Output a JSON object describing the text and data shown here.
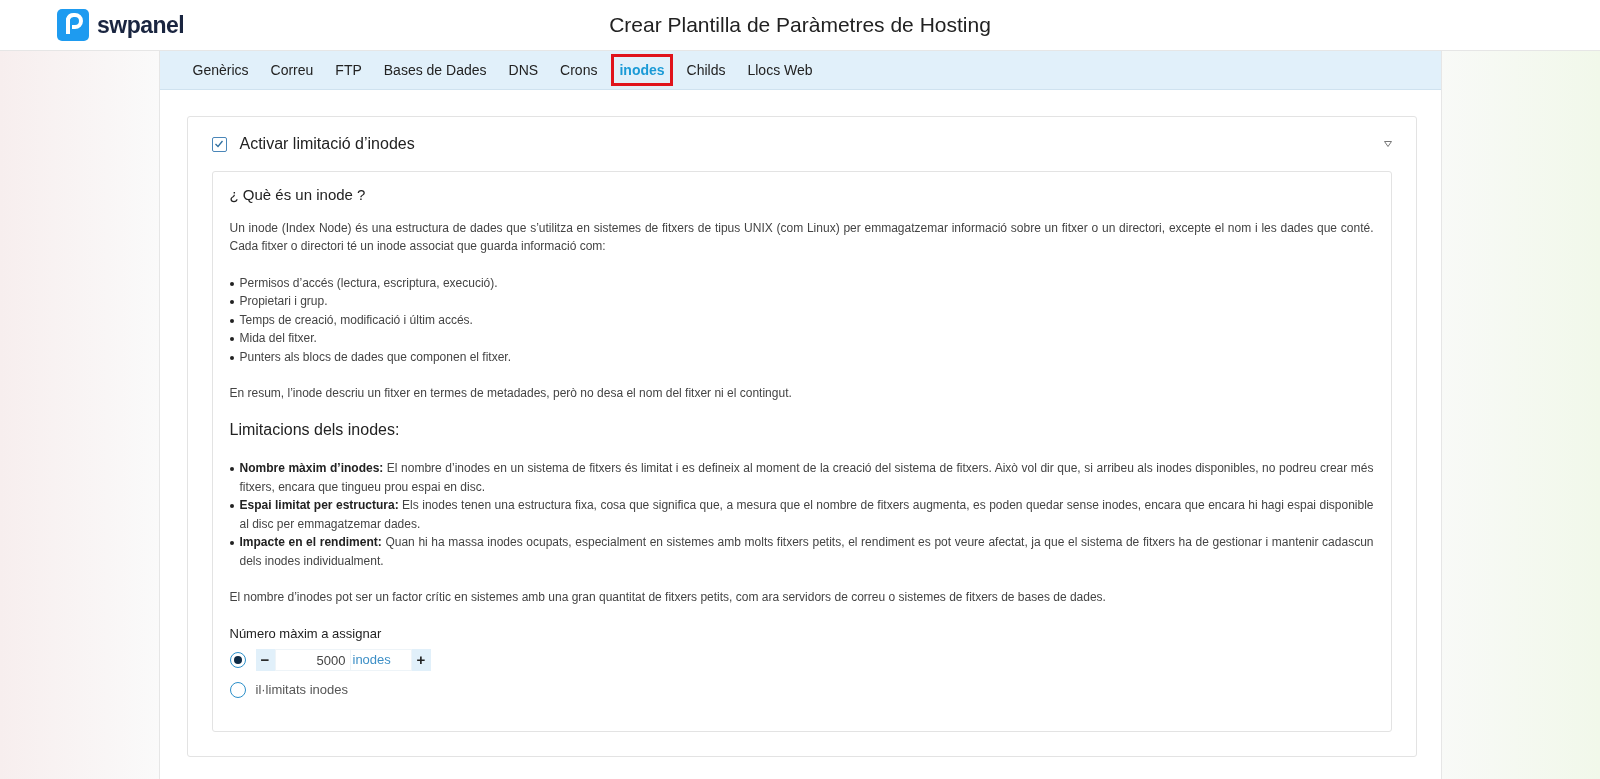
{
  "header": {
    "logo": "swpanel",
    "title": "Crear Plantilla de Paràmetres de Hosting"
  },
  "tabs": [
    {
      "label": "Genèrics",
      "selected": false
    },
    {
      "label": "Correu",
      "selected": false
    },
    {
      "label": "FTP",
      "selected": false
    },
    {
      "label": "Bases de Dades",
      "selected": false
    },
    {
      "label": "DNS",
      "selected": false
    },
    {
      "label": "Crons",
      "selected": false
    },
    {
      "label": "inodes",
      "selected": true
    },
    {
      "label": "Childs",
      "selected": false
    },
    {
      "label": "Llocs Web",
      "selected": false
    }
  ],
  "section": {
    "label": "Activar limitació d’inodes",
    "checked": true,
    "expanded": true,
    "info": {
      "heading": "¿ Què és un inode ?",
      "intro": "Un inode (Index Node) és una estructura de dades que s’utilitza en sistemes de fitxers de tipus UNIX (com Linux) per emmagatzemar informació sobre un fitxer o un directori, excepte el nom i les dades que conté. Cada fitxer o directori té un inode associat que guarda informació com:",
      "bullets": [
        "Permisos d’accés (lectura, escriptura, execució).",
        "Propietari i grup.",
        "Temps de creació, modificació i últim accés.",
        "Mida del fitxer.",
        "Punters als blocs de dades que componen el fitxer."
      ],
      "summary": "En resum, l’inode descriu un fitxer en termes de metadades, però no desa el nom del fitxer ni el contingut.",
      "limits_heading": "Limitacions dels inodes:",
      "limits": [
        "**Nombre màxim d’inodes:** El nombre d’inodes en un sistema de fitxers és limitat i es defineix al moment de la creació del sistema de fitxers. Això vol dir que, si arribeu als inodes disponibles, no podreu crear més fitxers, encara que tingueu prou espai en disc.",
        "**Espai limitat per estructura:** Els inodes tenen una estructura fixa, cosa que significa que, a mesura que el nombre de fitxers augmenta, es poden quedar sense inodes, encara que encara hi hagi espai disponible al disc per emmagatzemar dades.",
        "**Impacte en el rendiment:** Quan hi ha massa inodes ocupats, especialment en sistemes amb molts fitxers petits, el rendiment es pot veure afectat, ja que el sistema de fitxers ha de gestionar i mantenir cadascun dels inodes individualment."
      ],
      "closing": "El nombre d’inodes pot ser un factor crític en sistemes amb una gran quantitat de fitxers petits, com ara servidors de correu o sistemes de fitxers de bases de dades."
    },
    "field_label": "Número màxim a assignar",
    "options": [
      {
        "kind": "stepper",
        "selected": true,
        "minus": "−",
        "value": "5000",
        "unit": "inodes",
        "plus": "+"
      },
      {
        "kind": "plain",
        "selected": false,
        "label": "il·limitats inodes"
      }
    ]
  }
}
